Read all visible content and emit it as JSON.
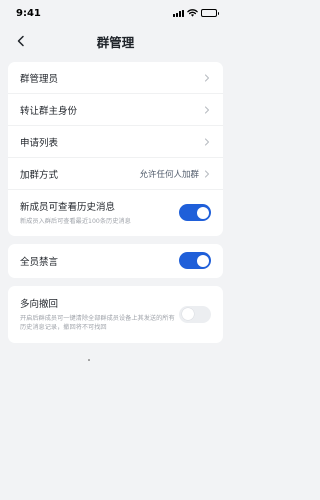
{
  "status_bar": {
    "time": "9:41"
  },
  "nav": {
    "title": "群管理"
  },
  "settings": {
    "group_admin": "群管理员",
    "transfer_owner": "转让群主身份",
    "application_list": "申请列表",
    "join_method": {
      "label": "加群方式",
      "value": "允许任何人加群"
    },
    "new_member_history": {
      "label": "新成员可查看历史消息",
      "desc": "新成员入群后可查看最近100条历史消息",
      "enabled": true
    },
    "mute_all": {
      "label": "全员禁言",
      "enabled": true
    },
    "multi_recall": {
      "label": "多向撤回",
      "desc": "开启后群成员可一键清除全部群成员设备上其发送的所有历史消息记录，撤回将不可找回",
      "enabled": false
    }
  },
  "colors": {
    "accent": "#1f5fd9",
    "background": "#f2f3f5"
  }
}
